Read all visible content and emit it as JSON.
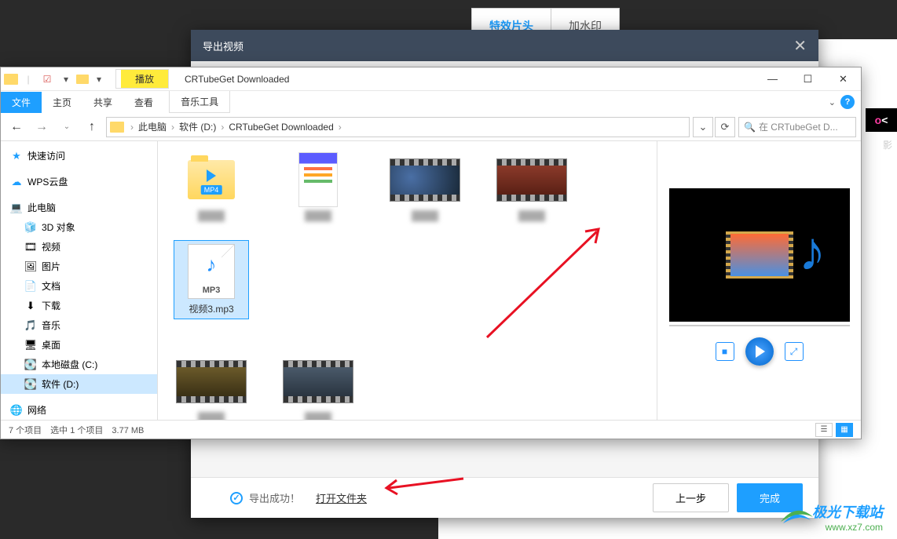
{
  "bg": {
    "tab1": "特效片头",
    "tab2": "加水印",
    "right_text": "影",
    "ok": "OK"
  },
  "export": {
    "title": "导出视频",
    "success": "导出成功！",
    "open_folder": "打开文件夹",
    "prev": "上一步",
    "done": "完成"
  },
  "explorer": {
    "title": "CRTubeGet Downloaded",
    "play_tab": "播放",
    "music_tools": "音乐工具",
    "tabs": {
      "file": "文件",
      "home": "主页",
      "share": "共享",
      "view": "查看"
    },
    "breadcrumb": {
      "pc": "此电脑",
      "drive": "软件 (D:)",
      "folder": "CRTubeGet Downloaded"
    },
    "search_placeholder": "在 CRTubeGet D...",
    "sidebar": {
      "quick": "快速访问",
      "wps": "WPS云盘",
      "pc": "此电脑",
      "items": [
        {
          "icon": "🧊",
          "label": "3D 对象"
        },
        {
          "icon": "🎞",
          "label": "视频"
        },
        {
          "icon": "🖼",
          "label": "图片"
        },
        {
          "icon": "📄",
          "label": "文档"
        },
        {
          "icon": "⬇",
          "label": "下载"
        },
        {
          "icon": "🎵",
          "label": "音乐"
        },
        {
          "icon": "🖥",
          "label": "桌面"
        },
        {
          "icon": "💽",
          "label": "本地磁盘 (C:)"
        },
        {
          "icon": "💽",
          "label": "软件 (D:)"
        }
      ],
      "network": "网络"
    },
    "files": {
      "mp4_badge": "MP4",
      "mp3_badge": "MP3",
      "selected_name": "视频3.mp3"
    },
    "status": "7 个项目　选中 1 个项目　3.77 MB"
  },
  "watermark": {
    "name": "极光下载站",
    "url": "www.xz7.com"
  }
}
